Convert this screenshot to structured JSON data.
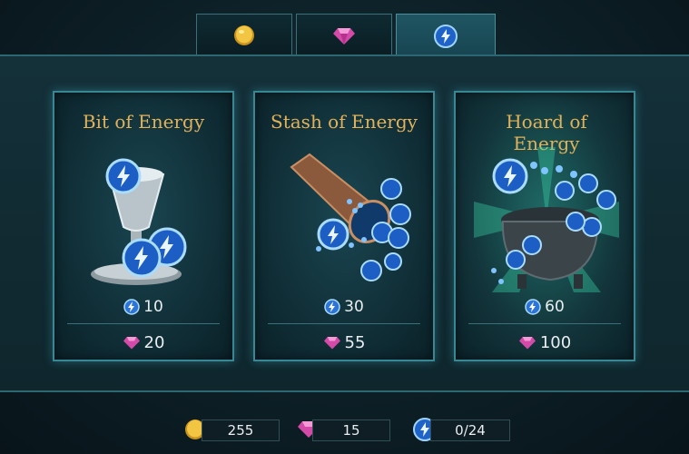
{
  "tabs": [
    {
      "icon": "gold-coin-icon"
    },
    {
      "icon": "gem-icon"
    },
    {
      "icon": "energy-icon",
      "active": true
    }
  ],
  "cards": [
    {
      "title": "Bit of Energy",
      "energy": "10",
      "price": "20",
      "price_icon": "gem-icon"
    },
    {
      "title": "Stash of Energy",
      "energy": "30",
      "price": "55",
      "price_icon": "gem-icon"
    },
    {
      "title": "Hoard of Energy",
      "energy": "60",
      "price": "100",
      "price_icon": "gem-icon"
    }
  ],
  "wallet": {
    "coins": "255",
    "gems": "15",
    "energy": "0/24"
  },
  "colors": {
    "title_gold": "#e2b25a",
    "card_border": "#3a8794",
    "energy_blue": "#3f8df0",
    "gem_pink": "#e05ab0"
  }
}
